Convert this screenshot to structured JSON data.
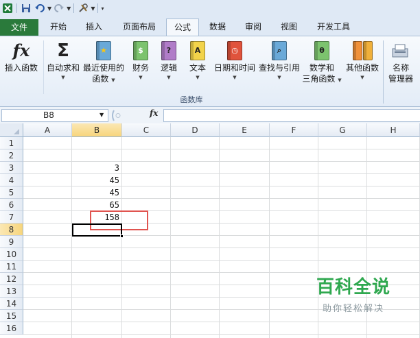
{
  "tabs": [
    {
      "label": "文件",
      "key": "file"
    },
    {
      "label": "开始",
      "key": "home"
    },
    {
      "label": "插入",
      "key": "insert"
    },
    {
      "label": "页面布局",
      "key": "layout"
    },
    {
      "label": "公式",
      "key": "formulas",
      "active": true
    },
    {
      "label": "数据",
      "key": "data"
    },
    {
      "label": "审阅",
      "key": "review"
    },
    {
      "label": "视图",
      "key": "view"
    },
    {
      "label": "开发工具",
      "key": "developer"
    }
  ],
  "ribbon": {
    "insert_function": "插入函数",
    "autosum": "自动求和",
    "recent_line1": "最近使用的",
    "recent_line2": "函数",
    "financial": "财务",
    "logical": "逻辑",
    "text": "文本",
    "datetime": "日期和时间",
    "lookup": "查找与引用",
    "math_line1": "数学和",
    "math_line2": "三角函数",
    "other": "其他函数",
    "name_line1": "名称",
    "name_line2": "管理器",
    "group_label": "函数库",
    "fx_glyph": "fx",
    "sigma_glyph": "Σ",
    "logical_glyph": "?",
    "text_glyph": "A",
    "math_glyph": "θ"
  },
  "formula_bar": {
    "name_box": "B8",
    "fx": "fx",
    "formula": ""
  },
  "grid": {
    "columns": [
      "A",
      "B",
      "C",
      "D",
      "E",
      "F",
      "G",
      "H"
    ],
    "rows": [
      "1",
      "2",
      "3",
      "4",
      "5",
      "6",
      "7",
      "8",
      "9",
      "10",
      "11",
      "12",
      "13",
      "14",
      "15",
      "16"
    ],
    "selected_column": "B",
    "selected_row": "8",
    "cells": {
      "B3": "3",
      "B4": "45",
      "B5": "45",
      "B6": "65",
      "B7": "158"
    }
  },
  "watermark": {
    "main": "百科全说",
    "sub": "助你轻松解决"
  },
  "colors": {
    "file_tab": "#2a7a3b",
    "highlight": "#e0544f",
    "watermark": "#2fa84f"
  }
}
